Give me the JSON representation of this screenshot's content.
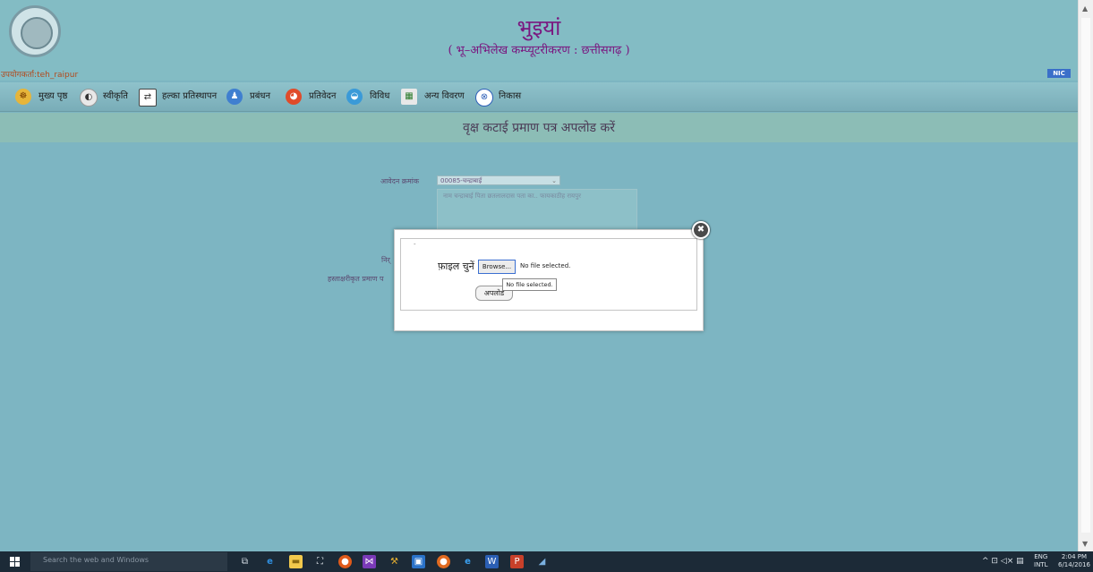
{
  "header": {
    "title": "भुइयां",
    "subtitle": "( भू–अभिलेख कम्प्यूटरीकरण : छत्तीसगढ़ )",
    "user_line": "उपयोगकर्ता:teh_raipur",
    "nic_badge": "NIC"
  },
  "menu": {
    "items": [
      {
        "label": "मुख्य पृष्ठ",
        "icon": "home-emblem-icon"
      },
      {
        "label": "स्वीकृति",
        "icon": "approval-icon"
      },
      {
        "label": "हल्का प्रतिस्थापन",
        "icon": "swap-arrows-icon"
      },
      {
        "label": "प्रबंधन",
        "icon": "people-icon"
      },
      {
        "label": "प्रतिवेदन",
        "icon": "report-icon"
      },
      {
        "label": "विविध",
        "icon": "misc-icon"
      },
      {
        "label": "अन्य विवरण",
        "icon": "details-icon"
      },
      {
        "label": "निकास",
        "icon": "exit-icon"
      }
    ]
  },
  "page": {
    "title": "वृक्ष कटाई प्रमाण पत्र अपलोड करें"
  },
  "form": {
    "application_label": "आवेदन क्रमांक",
    "application_value": "00085-चन्द्राबाई",
    "grid_header": "नाम  चन्द्राबाई   पिता   छतलालदास  पता  का..  फायकाठीह  रायपुर",
    "label_partial_1": "निर्",
    "label_partial_2": "हस्ताक्षरीकृत प्रमाण प"
  },
  "modal": {
    "legend": "-",
    "choose_file_label": "फ़ाइल चुनें",
    "browse_label": "Browse...",
    "no_file_text": "No file selected.",
    "tooltip_text": "No file selected.",
    "upload_label": "अपलोड",
    "close_glyph": "✖"
  },
  "taskbar": {
    "search_placeholder": "Search the web and Windows",
    "lang_top": "ENG",
    "lang_bottom": "INTL",
    "time": "2:04 PM",
    "date": "6/14/2016",
    "tray_icons": "^  ⊡  ◁×  ▤"
  },
  "colors": {
    "page_bg": "#7db5c2",
    "title_color": "#7a1880",
    "taskbar_bg": "#1c2a37"
  }
}
